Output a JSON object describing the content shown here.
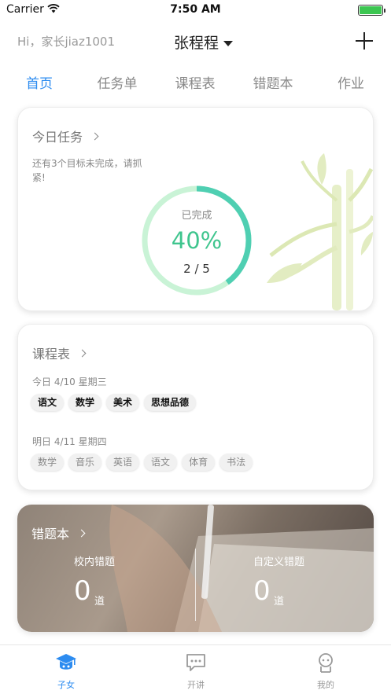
{
  "status_bar": {
    "carrier": "Carrier",
    "time": "7:50 AM",
    "battery_color": "#3cc651"
  },
  "header": {
    "greeting": "Hi，家长jiaz1001",
    "child_name": "张程程",
    "add_icon": "plus-icon"
  },
  "tabs": [
    {
      "label": "首页",
      "active": true
    },
    {
      "label": "任务单",
      "active": false
    },
    {
      "label": "课程表",
      "active": false
    },
    {
      "label": "错题本",
      "active": false
    },
    {
      "label": "作业",
      "active": false
    }
  ],
  "today_task": {
    "title": "今日任务",
    "hint": "还有3个目标未完成，请抓紧!",
    "done_label": "已完成",
    "percent_text": "40%",
    "progress": 0.4,
    "count_text": "2 / 5",
    "accent": "#3fc58e"
  },
  "course_schedule": {
    "title": "课程表",
    "today_label": "今日 4/10 星期三",
    "today_subjects": [
      "语文",
      "数学",
      "美术",
      "思想品德"
    ],
    "tomorrow_label": "明日 4/11 星期四",
    "tomorrow_subjects": [
      "数学",
      "音乐",
      "英语",
      "语文",
      "体育",
      "书法"
    ]
  },
  "mistake_book": {
    "title": "错题本",
    "school": {
      "label": "校内错题",
      "count": "0",
      "unit": "道"
    },
    "custom": {
      "label": "自定义错题",
      "count": "0",
      "unit": "道"
    }
  },
  "bottom_nav": [
    {
      "label": "子女",
      "icon": "graduation-cap-icon",
      "active": true
    },
    {
      "label": "开讲",
      "icon": "chat-bubble-icon",
      "active": false
    },
    {
      "label": "我的",
      "icon": "user-icon",
      "active": false
    }
  ],
  "colors": {
    "accent_blue": "#2d8cf0",
    "ring_green": "#3fc58e",
    "ring_track": "#c9f3d6"
  }
}
